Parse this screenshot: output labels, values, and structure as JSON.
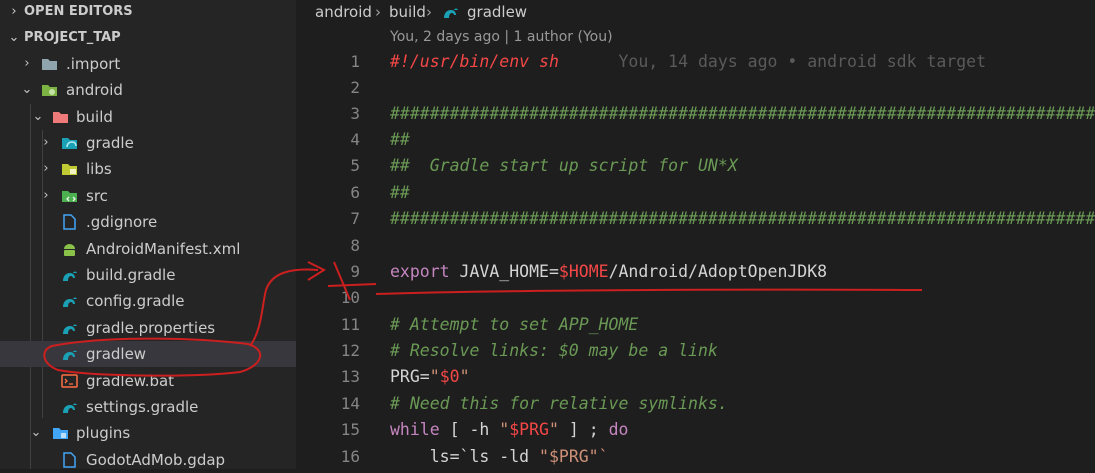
{
  "sidebar": {
    "open_editors": "OPEN EDITORS",
    "project": "PROJECT_TAP",
    "rows": [
      {
        "label": ".import"
      },
      {
        "label": "android"
      },
      {
        "label": "build"
      },
      {
        "label": "gradle"
      },
      {
        "label": "libs"
      },
      {
        "label": "src"
      },
      {
        "label": ".gdignore"
      },
      {
        "label": "AndroidManifest.xml"
      },
      {
        "label": "build.gradle"
      },
      {
        "label": "config.gradle"
      },
      {
        "label": "gradle.properties"
      },
      {
        "label": "gradlew"
      },
      {
        "label": "gradlew.bat"
      },
      {
        "label": "settings.gradle"
      },
      {
        "label": "plugins"
      },
      {
        "label": "GodotAdMob.gdap"
      }
    ]
  },
  "breadcrumb": {
    "p1": "android",
    "p2": "build",
    "p3": "gradlew"
  },
  "codelens": "You, 2 days ago | 1 author (You)",
  "gutter": [
    "1",
    "2",
    "3",
    "4",
    "5",
    "6",
    "7",
    "8",
    "9",
    "10",
    "11",
    "12",
    "13",
    "14",
    "15",
    "16"
  ],
  "code": {
    "l1": "#!/usr/bin/env sh",
    "l1_blame": "You, 14 days ago • android sdk target",
    "l3": "#############################################################################",
    "l4": "##",
    "l5": "##  Gradle start up script for UN*X",
    "l6": "##",
    "l7": "#############################################################################",
    "l9_kw": "export",
    "l9_a": " JAVA_HOME=",
    "l9_var": "$HOME",
    "l9_b": "/Android/AdoptOpenJDK8",
    "l11": "# Attempt to set APP_HOME",
    "l12": "# Resolve links: $0 may be a link",
    "l13_a": "PRG=",
    "l13_q1": "\"",
    "l13_var": "$0",
    "l13_q2": "\"",
    "l14": "# Need this for relative symlinks.",
    "l15_kw": "while",
    "l15_a": " [ -h ",
    "l15_q1": "\"",
    "l15_var": "$PRG",
    "l15_q2": "\"",
    "l15_b": " ] ; ",
    "l15_kw2": "do",
    "l16_a": "    ls=`ls -ld ",
    "l16_q": "\"$PRG\"`"
  },
  "colors": {
    "annotation": "#cc1f1f",
    "selected_row": "#37373d",
    "gradle_icon": "#1ba1b5"
  }
}
